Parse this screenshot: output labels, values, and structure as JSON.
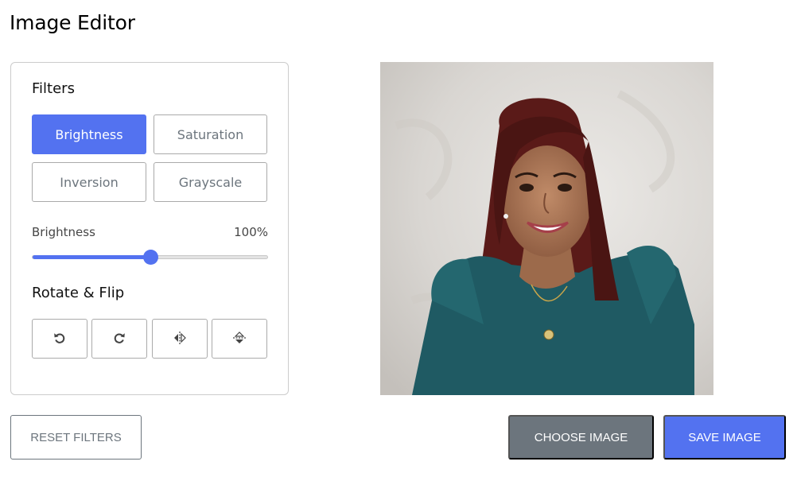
{
  "app": {
    "title": "Image Editor"
  },
  "filters": {
    "heading": "Filters",
    "options": [
      {
        "label": "Brightness",
        "active": true
      },
      {
        "label": "Saturation",
        "active": false
      },
      {
        "label": "Inversion",
        "active": false
      },
      {
        "label": "Grayscale",
        "active": false
      }
    ]
  },
  "slider": {
    "name": "Brightness",
    "value_text": "100%",
    "value": 100,
    "max": 200
  },
  "rotate": {
    "heading": "Rotate & Flip",
    "buttons": [
      "rotate-left-icon",
      "rotate-right-icon",
      "flip-horizontal-icon",
      "flip-vertical-icon"
    ]
  },
  "preview": {
    "image": "portrait-photo"
  },
  "actions": {
    "reset_label": "RESET FILTERS",
    "choose_label": "CHOOSE IMAGE",
    "save_label": "SAVE IMAGE"
  },
  "colors": {
    "accent": "#5372f0",
    "secondary": "#6c757d",
    "border": "#cccccc"
  }
}
